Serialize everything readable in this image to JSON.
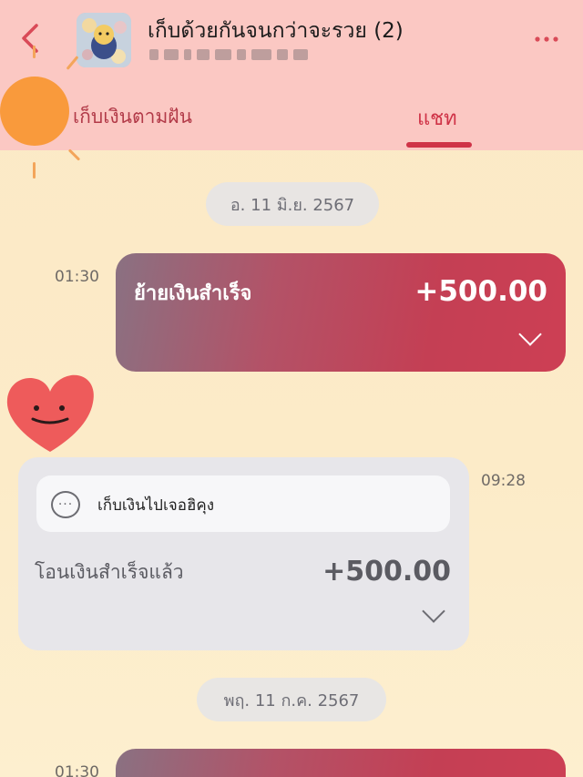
{
  "header": {
    "title": "เก็บด้วยกันจนกว่าจะรวย (2)",
    "subtitle_blurred": "",
    "tabs": [
      {
        "label": "เก็บเงินตามฝัน",
        "active": false
      },
      {
        "label": "แชท",
        "active": true
      }
    ]
  },
  "messages": [
    {
      "date": "อ. 11 มิ.ย. 2567",
      "time": "01:30",
      "label": "ย้ายเงินสำเร็จ",
      "amount": "+500.00"
    },
    {
      "time": "09:28",
      "note": "เก็บเงินไปเจอฮิคุง",
      "label": "โอนเงินสำเร็จแล้ว",
      "amount": "+500.00"
    },
    {
      "date": "พฤ. 11 ก.ค. 2567",
      "time": "01:30"
    }
  ],
  "colors": {
    "accent": "#cf3347",
    "header_bg": "#fbc8c3",
    "page_bg": "#fcebc8",
    "card_red": "#c43f54",
    "card_gray": "#e7e6ea"
  },
  "icons": [
    "back-chevron-icon",
    "more-dots-icon",
    "chat-bubble-icon",
    "chevron-down-icon",
    "heart-face-sticker",
    "sun-sticker"
  ]
}
